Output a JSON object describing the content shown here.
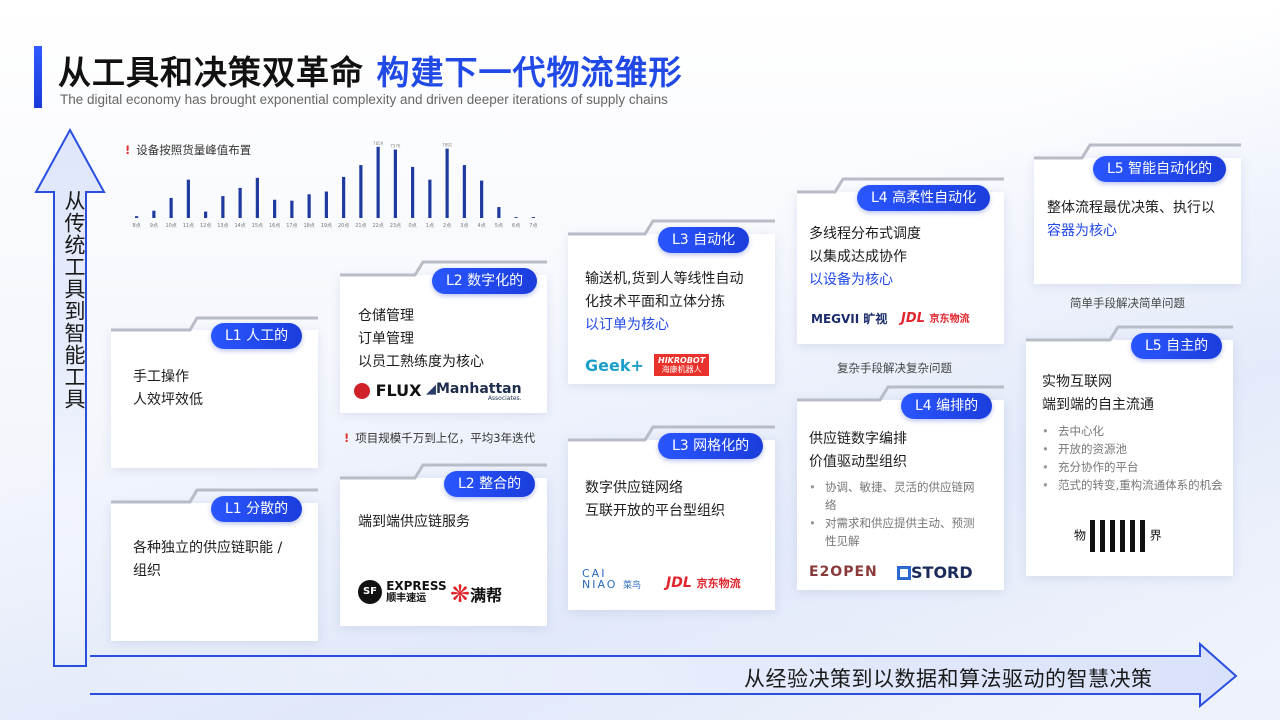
{
  "header": {
    "title_main": "从工具和决策双革命 ",
    "title_accent": "构建下一代物流雏形",
    "subtitle": "The digital economy has brought exponential complexity and driven deeper iterations of supply chains"
  },
  "axes": {
    "vertical_label": "从传统工具到智能工具",
    "horizontal_label": "从经验决策到以数据和算法驱动的智慧决策"
  },
  "chart_note": "设备按照货量峰值布置",
  "chart_data": {
    "type": "bar",
    "title": "",
    "categories": [
      "8点",
      "9点",
      "10点",
      "11点",
      "12点",
      "13点",
      "14点",
      "15点",
      "16点",
      "17点",
      "18点",
      "19点",
      "20点",
      "21点",
      "22点",
      "23点",
      "0点",
      "1点",
      "2点",
      "3点",
      "4点",
      "5点",
      "6点",
      "7点"
    ],
    "values": [
      200,
      800,
      2200,
      4200,
      700,
      2400,
      3300,
      4400,
      2000,
      1900,
      2600,
      2900,
      4500,
      5800,
      7800,
      7500,
      5600,
      4200,
      7600,
      5800,
      4100,
      1200,
      100,
      100
    ],
    "data_labels": {
      "14": "7859",
      "15": "7576",
      "18": "7891"
    },
    "color": "#1f3a9e"
  },
  "notes": {
    "project": "项目规模千万到上亿，平均3年迭代",
    "complex": "复杂手段解决复杂问题",
    "simple": "简单手段解决简单问题"
  },
  "cards": {
    "l1_manual": {
      "tag": "L1 人工的",
      "lines": [
        "手工操作",
        "人效坪效低"
      ]
    },
    "l1_scattered": {
      "tag": "L1 分散的",
      "lines": [
        "各种独立的供应链职能 /",
        "组织"
      ]
    },
    "l2_digital": {
      "tag": "L2 数字化的",
      "lines": [
        "仓储管理",
        "订单管理",
        "以员工熟练度为核心"
      ],
      "logos": [
        "FLUX",
        "Manhattan",
        "Associates."
      ]
    },
    "l2_integrated": {
      "tag": "L2 整合的",
      "lines": [
        "端到端供应链服务"
      ],
      "logos": [
        "EXPRESS",
        "顺丰速运",
        "满帮"
      ]
    },
    "l3_auto": {
      "tag": "L3 自动化",
      "lines": [
        "输送机,货到人等线性自动",
        "化技术平面和立体分拣",
        "以订单为核心"
      ],
      "logos": [
        "Geek+",
        "HIKROBOT",
        "海康机器人"
      ]
    },
    "l3_network": {
      "tag": "L3 网格化的",
      "lines": [
        "数字供应链网络",
        "互联开放的平台型组织"
      ],
      "logos": [
        "CAI",
        "NIAO",
        "菜鸟",
        "JDL",
        "京东物流"
      ]
    },
    "l4_flexible": {
      "tag": "L4 高柔性自动化",
      "lines": [
        "多线程分布式调度",
        "以集成达成协作",
        "以设备为核心"
      ],
      "logos": [
        "MEGVII",
        "旷视",
        "JDL",
        "京东物流"
      ]
    },
    "l4_orchestrated": {
      "tag": "L4 编排的",
      "lines": [
        "供应链数字编排",
        "价值驱动型组织"
      ],
      "bullets": [
        "协调、敏捷、灵活的供应链网络",
        "对需求和供应提供主动、预测性见解"
      ],
      "logos": [
        "E2OPEN",
        "STORD"
      ]
    },
    "l5_intelligent": {
      "tag": "L5 智能自动化的",
      "lines": [
        "整体流程最优决策、执行以",
        "容器为核心"
      ]
    },
    "l5_autonomous": {
      "tag": "L5 自主的",
      "lines": [
        "实物互联网",
        "端到端的自主流通"
      ],
      "bullets": [
        "去中心化",
        "开放的资源池",
        "充分协作的平台",
        "范式的转变,重构流通体系的机会"
      ],
      "logos": [
        "物",
        "界"
      ]
    }
  }
}
